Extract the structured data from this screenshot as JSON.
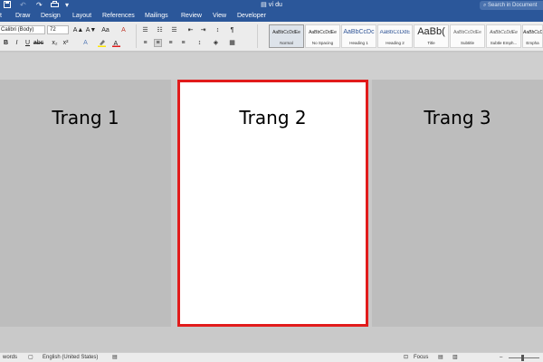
{
  "window": {
    "title": "ví du",
    "search_placeholder": "Search in Document"
  },
  "quick_access": {
    "save_icon": "save-icon",
    "undo_icon": "undo-icon",
    "redo_icon": "redo-icon",
    "print_icon": "print-icon",
    "customize_icon": "customize-toolbar-icon"
  },
  "tabs": [
    "t",
    "Draw",
    "Design",
    "Layout",
    "References",
    "Mailings",
    "Review",
    "View",
    "Developer"
  ],
  "ribbon": {
    "font_name": "Calibri (Body)",
    "font_size": "72",
    "grow_font": "A▲",
    "shrink_font": "A▼",
    "change_case": "Aa",
    "clear_format": "A",
    "bold": "B",
    "italic": "I",
    "paragraph_mark": "¶",
    "highlight_color": "#ffe600",
    "font_color": "#e11b1b",
    "styles": [
      {
        "sample": "AaBbCcDdEe",
        "name": "Normal"
      },
      {
        "sample": "AaBbCcDdEe",
        "name": "No Spacing"
      },
      {
        "sample": "AaBbCcDc",
        "name": "Heading 1"
      },
      {
        "sample": "AaBbCcDdE",
        "name": "Heading 2"
      },
      {
        "sample": "AaBb(",
        "name": "Title"
      },
      {
        "sample": "AaBbCcDdEe",
        "name": "Subtitle"
      },
      {
        "sample": "AaBbCcDdEe",
        "name": "Subtle Emph..."
      },
      {
        "sample": "AaBbCcDdEe",
        "name": "Empha"
      }
    ]
  },
  "pages": [
    {
      "title": "Trang 1"
    },
    {
      "title": "Trang 2"
    },
    {
      "title": "Trang 3"
    }
  ],
  "status": {
    "words": "words",
    "language": "English (United States)",
    "focus": "Focus",
    "accent": "#2b579a",
    "selection_color": "#e11b1b"
  }
}
